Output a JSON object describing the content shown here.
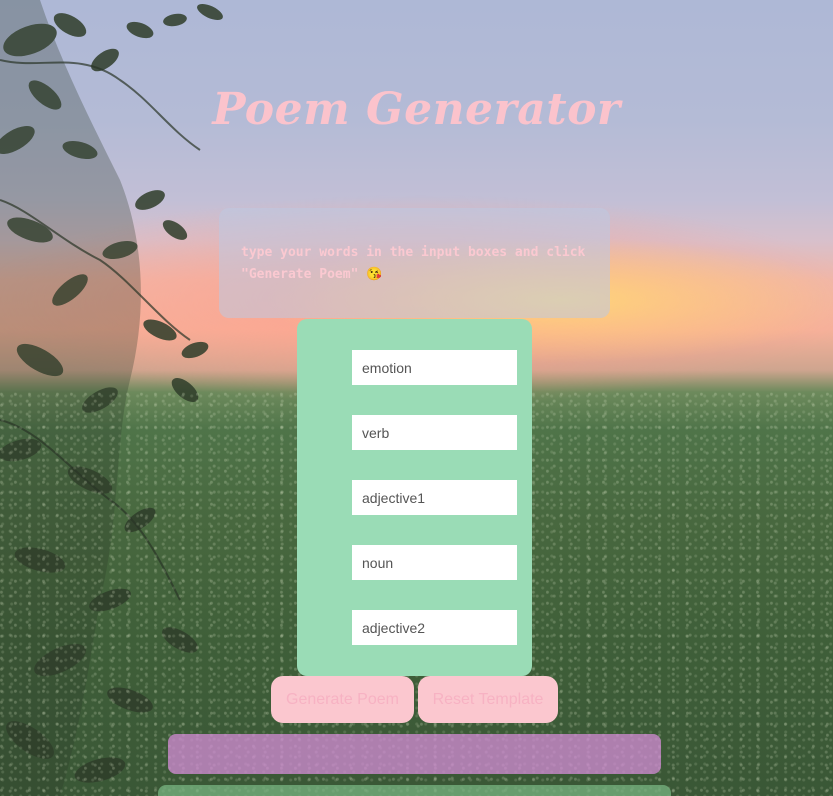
{
  "app": {
    "title": "Poem Generator"
  },
  "instructions": {
    "text": "type your words in the input boxes and click \"Generate Poem\" 😘"
  },
  "form": {
    "fields": [
      {
        "placeholder": "emotion"
      },
      {
        "placeholder": "verb"
      },
      {
        "placeholder": "adjective1"
      },
      {
        "placeholder": "noun"
      },
      {
        "placeholder": "adjective2"
      }
    ]
  },
  "buttons": {
    "generate_label": "Generate Poem",
    "reset_label": "Reset Template"
  },
  "colors": {
    "title": "#fbc3cc",
    "form_panel": "#9adcb6",
    "button_bg": "#fbc7cf",
    "button_text": "#f7b2c3",
    "output_box": "#d48cd7",
    "template_box": "#78b482"
  }
}
